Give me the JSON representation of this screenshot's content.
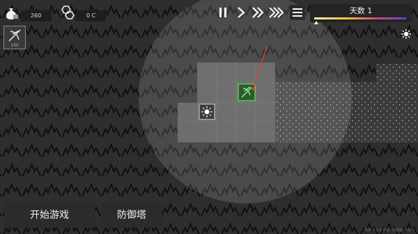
{
  "hud": {
    "money_value": "260",
    "resource_value": "0 C"
  },
  "tower_card": {
    "cost": "100",
    "icon": "crossbow-icon"
  },
  "speed_controls": [
    {
      "name": "pause-button",
      "icon": "pause-icon"
    },
    {
      "name": "play-button",
      "icon": "play-icon"
    },
    {
      "name": "fast-forward-button",
      "icon": "fast-forward-icon"
    },
    {
      "name": "fastest-forward-button",
      "icon": "fastest-forward-icon"
    }
  ],
  "day_panel": {
    "label": "天数 1",
    "progress": 0.02
  },
  "weather_icon": "sun-icon",
  "buttons": {
    "start_game": "开始游戏",
    "tower_defense": "防御塔"
  },
  "version_text": "版本 0.1.3 测试 (稳定版) 2024",
  "colors": {
    "background": "#1f1f1f",
    "mountain_tile": "#2e2e2e",
    "mountain_line": "#0f0f0f",
    "lit_area": "#ffffff",
    "tower_green": "#5ec65c",
    "laser_red": "#e23b3b"
  }
}
